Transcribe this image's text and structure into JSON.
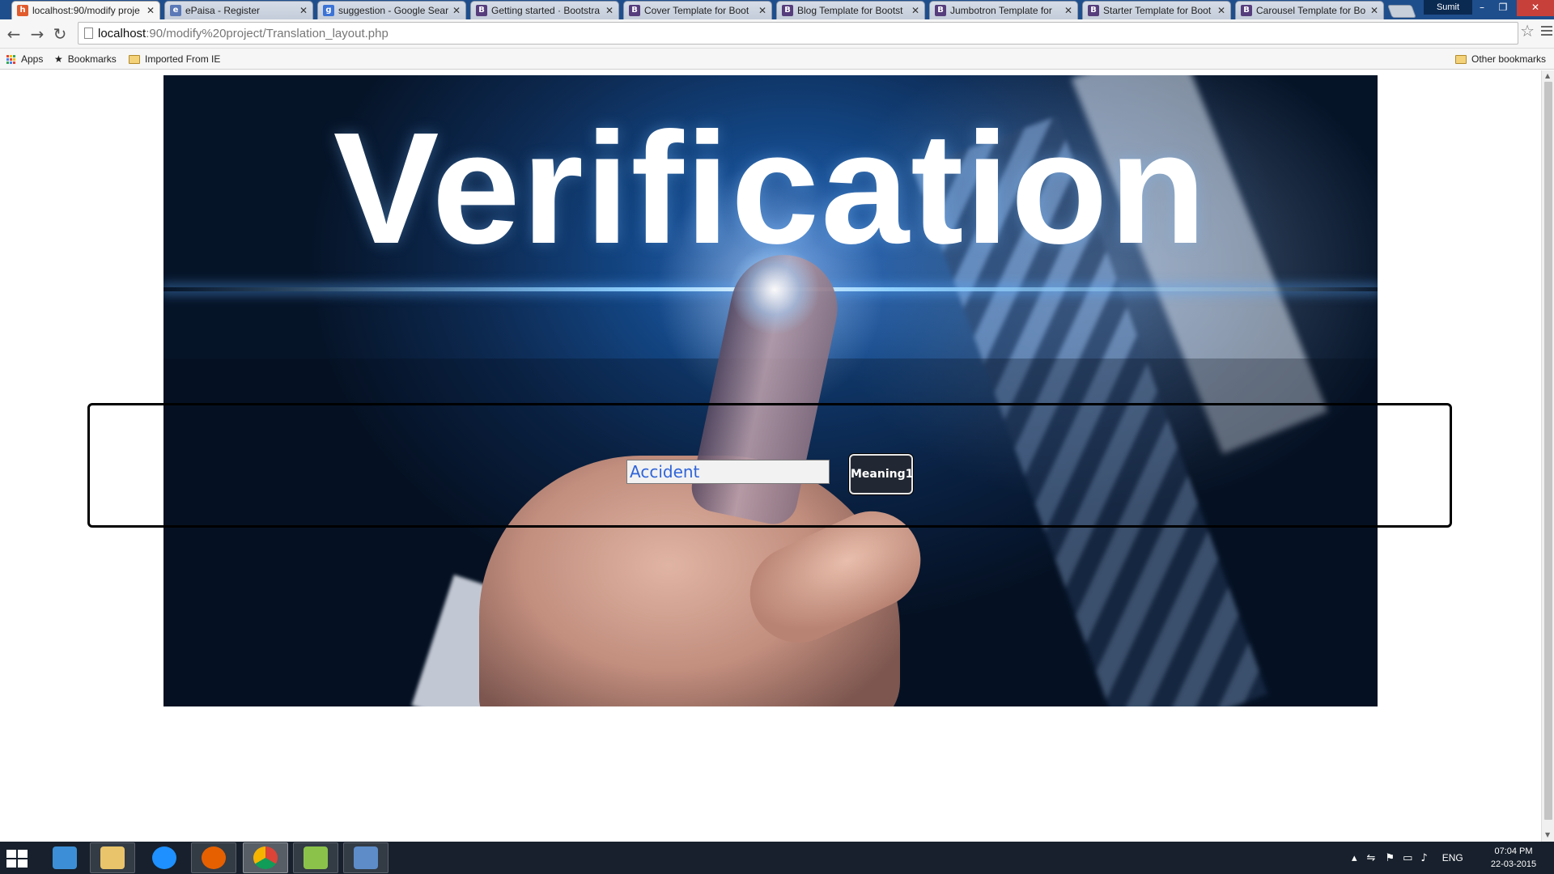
{
  "browser": {
    "tabs": [
      {
        "title": "localhost:90/modify proje",
        "icon": "html-page-icon",
        "color": "#e25b2c",
        "active": true
      },
      {
        "title": "ePaisa - Register",
        "icon": "epaisa-icon",
        "color": "#5b79b7",
        "active": false
      },
      {
        "title": "suggestion - Google Sear",
        "icon": "google-icon",
        "color": "#3b73d6",
        "active": false
      },
      {
        "title": "Getting started · Bootstra",
        "icon": "bootstrap-icon",
        "color": "#563d7c",
        "active": false
      },
      {
        "title": "Cover Template for Boot",
        "icon": "bootstrap-icon",
        "color": "#563d7c",
        "active": false
      },
      {
        "title": "Blog Template for Bootst",
        "icon": "bootstrap-icon",
        "color": "#563d7c",
        "active": false
      },
      {
        "title": "Jumbotron Template for",
        "icon": "bootstrap-icon",
        "color": "#563d7c",
        "active": false
      },
      {
        "title": "Starter Template for Boot",
        "icon": "bootstrap-icon",
        "color": "#563d7c",
        "active": false
      },
      {
        "title": "Carousel Template for Bo",
        "icon": "bootstrap-icon",
        "color": "#563d7c",
        "active": false
      }
    ],
    "favicon_letters": {
      "g": "g",
      "b": "B",
      "e": "e",
      "h": "h"
    },
    "profile_name": "Sumit",
    "window_controls": {
      "minimize": "–",
      "maximize": "❐",
      "close": "✕"
    },
    "address": {
      "host": "localhost",
      "rest": ":90/modify%20project/Translation_layout.php"
    },
    "nav": {
      "back": "←",
      "forward": "→",
      "reload": "↻",
      "star": "☆"
    },
    "bookmarks": {
      "apps": "Apps",
      "bookmarks": "Bookmarks",
      "imported": "Imported From IE",
      "other": "Other bookmarks"
    }
  },
  "page": {
    "hero_title": "Verification",
    "word_input_value": "Accident",
    "meaning_button_label": "Meaning1"
  },
  "taskbar": {
    "apps": [
      {
        "name": "explorer-window",
        "color": "#3c8fd6"
      },
      {
        "name": "file-explorer",
        "color": "#e9c46a"
      },
      {
        "name": "internet-explorer",
        "color": "#1e90ff"
      },
      {
        "name": "firefox",
        "color": "#e66000"
      },
      {
        "name": "chrome",
        "color": "#4caf50"
      },
      {
        "name": "notepad-plus",
        "color": "#8bc34a"
      },
      {
        "name": "remote-desktop",
        "color": "#5d8cc9"
      }
    ],
    "language": "ENG",
    "time": "07:04 PM",
    "date": "22-03-2015"
  }
}
